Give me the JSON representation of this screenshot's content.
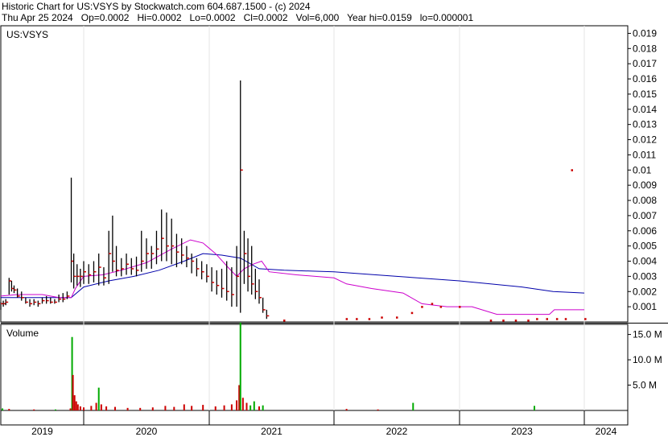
{
  "header": {
    "line1": "Historic Chart for US:VSYS by Stockwatch.com 604.687.1500 - (c) 2024",
    "line2": "Thu Apr 25 2024   Op=0.0002   Hi=0.0002   Lo=0.0002   Cl=0.0002   Vol=6,000   Year hi=0.0159   lo=0.000001"
  },
  "colors": {
    "price": "#000000",
    "close_tick": "#cc0000",
    "ma_short": "#cc00cc",
    "ma_long": "#0000aa",
    "vol_up": "#00aa00",
    "vol_down": "#cc0000"
  },
  "chart_data": [
    {
      "type": "line",
      "title": "US:VSYS",
      "x_labels": [
        "2019",
        "2020",
        "2021",
        "2022",
        "2023",
        "2024"
      ],
      "ylim": [
        0,
        0.0195
      ],
      "y_ticks": [
        "0.001",
        "0.002",
        "0.003",
        "0.004",
        "0.005",
        "0.006",
        "0.007",
        "0.008",
        "0.009",
        "0.01",
        "0.011",
        "0.012",
        "0.013",
        "0.014",
        "0.015",
        "0.016",
        "0.017",
        "0.018",
        "0.019"
      ],
      "price_hl": [
        {
          "x": 0.0,
          "hi": 0.0013,
          "lo": 0.0008,
          "c": 0.0012
        },
        {
          "x": 0.03,
          "hi": 0.0014,
          "lo": 0.001,
          "c": 0.0012
        },
        {
          "x": 0.06,
          "hi": 0.0015,
          "lo": 0.0011,
          "c": 0.0013
        },
        {
          "x": 0.1,
          "hi": 0.0029,
          "lo": 0.0018,
          "c": 0.0027
        },
        {
          "x": 0.13,
          "hi": 0.0027,
          "lo": 0.002,
          "c": 0.0022
        },
        {
          "x": 0.16,
          "hi": 0.0024,
          "lo": 0.0019,
          "c": 0.0021
        },
        {
          "x": 0.2,
          "hi": 0.0022,
          "lo": 0.0016,
          "c": 0.0017
        },
        {
          "x": 0.25,
          "hi": 0.002,
          "lo": 0.0014,
          "c": 0.0016
        },
        {
          "x": 0.3,
          "hi": 0.0016,
          "lo": 0.0012,
          "c": 0.0013
        },
        {
          "x": 0.35,
          "hi": 0.0015,
          "lo": 0.001,
          "c": 0.0012
        },
        {
          "x": 0.4,
          "hi": 0.0015,
          "lo": 0.0011,
          "c": 0.0013
        },
        {
          "x": 0.45,
          "hi": 0.0014,
          "lo": 0.001,
          "c": 0.0012
        },
        {
          "x": 0.5,
          "hi": 0.0016,
          "lo": 0.0012,
          "c": 0.0014
        },
        {
          "x": 0.55,
          "hi": 0.0017,
          "lo": 0.0012,
          "c": 0.0014
        },
        {
          "x": 0.6,
          "hi": 0.0016,
          "lo": 0.0012,
          "c": 0.0013
        },
        {
          "x": 0.65,
          "hi": 0.0015,
          "lo": 0.0012,
          "c": 0.0013
        },
        {
          "x": 0.7,
          "hi": 0.0018,
          "lo": 0.0013,
          "c": 0.0015
        },
        {
          "x": 0.75,
          "hi": 0.0019,
          "lo": 0.0013,
          "c": 0.0015
        },
        {
          "x": 0.8,
          "hi": 0.002,
          "lo": 0.0015,
          "c": 0.0017
        },
        {
          "x": 0.85,
          "hi": 0.0095,
          "lo": 0.0026,
          "c": 0.004
        },
        {
          "x": 0.88,
          "hi": 0.0045,
          "lo": 0.0022,
          "c": 0.003
        },
        {
          "x": 0.92,
          "hi": 0.0038,
          "lo": 0.0024,
          "c": 0.003
        },
        {
          "x": 0.96,
          "hi": 0.0035,
          "lo": 0.0023,
          "c": 0.003
        },
        {
          "x": 1.0,
          "hi": 0.004,
          "lo": 0.0025,
          "c": 0.0033
        },
        {
          "x": 1.04,
          "hi": 0.0038,
          "lo": 0.0025,
          "c": 0.0031
        },
        {
          "x": 1.08,
          "hi": 0.004,
          "lo": 0.0026,
          "c": 0.0033
        },
        {
          "x": 1.12,
          "hi": 0.0045,
          "lo": 0.0024,
          "c": 0.0036
        },
        {
          "x": 1.16,
          "hi": 0.0036,
          "lo": 0.0024,
          "c": 0.0029
        },
        {
          "x": 1.2,
          "hi": 0.006,
          "lo": 0.0025,
          "c": 0.0045
        },
        {
          "x": 1.23,
          "hi": 0.007,
          "lo": 0.0033,
          "c": 0.004
        },
        {
          "x": 1.26,
          "hi": 0.005,
          "lo": 0.003,
          "c": 0.0034
        },
        {
          "x": 1.3,
          "hi": 0.0042,
          "lo": 0.003,
          "c": 0.0035
        },
        {
          "x": 1.34,
          "hi": 0.0045,
          "lo": 0.0031,
          "c": 0.0038
        },
        {
          "x": 1.38,
          "hi": 0.0042,
          "lo": 0.0031,
          "c": 0.0035
        },
        {
          "x": 1.42,
          "hi": 0.0043,
          "lo": 0.003,
          "c": 0.0034
        },
        {
          "x": 1.46,
          "hi": 0.006,
          "lo": 0.0033,
          "c": 0.004
        },
        {
          "x": 1.5,
          "hi": 0.0055,
          "lo": 0.0035,
          "c": 0.0045
        },
        {
          "x": 1.54,
          "hi": 0.005,
          "lo": 0.0035,
          "c": 0.0045
        },
        {
          "x": 1.58,
          "hi": 0.006,
          "lo": 0.0038,
          "c": 0.0048
        },
        {
          "x": 1.62,
          "hi": 0.0074,
          "lo": 0.004,
          "c": 0.0055
        },
        {
          "x": 1.66,
          "hi": 0.0072,
          "lo": 0.004,
          "c": 0.005
        },
        {
          "x": 1.7,
          "hi": 0.0068,
          "lo": 0.0038,
          "c": 0.005
        },
        {
          "x": 1.74,
          "hi": 0.0058,
          "lo": 0.0036,
          "c": 0.0046
        },
        {
          "x": 1.78,
          "hi": 0.0055,
          "lo": 0.0038,
          "c": 0.0044
        },
        {
          "x": 1.82,
          "hi": 0.005,
          "lo": 0.0036,
          "c": 0.0042
        },
        {
          "x": 1.86,
          "hi": 0.0045,
          "lo": 0.0032,
          "c": 0.004
        },
        {
          "x": 1.9,
          "hi": 0.0042,
          "lo": 0.003,
          "c": 0.0035
        },
        {
          "x": 1.94,
          "hi": 0.004,
          "lo": 0.0028,
          "c": 0.0033
        },
        {
          "x": 1.98,
          "hi": 0.0038,
          "lo": 0.0026,
          "c": 0.003
        },
        {
          "x": 2.02,
          "hi": 0.0036,
          "lo": 0.002,
          "c": 0.0026
        },
        {
          "x": 2.06,
          "hi": 0.0034,
          "lo": 0.0018,
          "c": 0.0024
        },
        {
          "x": 2.1,
          "hi": 0.0035,
          "lo": 0.0016,
          "c": 0.0022
        },
        {
          "x": 2.14,
          "hi": 0.004,
          "lo": 0.0014,
          "c": 0.002
        },
        {
          "x": 2.18,
          "hi": 0.0036,
          "lo": 0.001,
          "c": 0.0018
        },
        {
          "x": 2.22,
          "hi": 0.005,
          "lo": 0.001,
          "c": 0.003
        },
        {
          "x": 2.25,
          "hi": 0.0159,
          "lo": 0.0006,
          "c": 0.01
        },
        {
          "x": 2.28,
          "hi": 0.006,
          "lo": 0.0025,
          "c": 0.0045
        },
        {
          "x": 2.31,
          "hi": 0.0055,
          "lo": 0.002,
          "c": 0.003
        },
        {
          "x": 2.34,
          "hi": 0.005,
          "lo": 0.0018,
          "c": 0.0025
        },
        {
          "x": 2.37,
          "hi": 0.0035,
          "lo": 0.0015,
          "c": 0.002
        },
        {
          "x": 2.4,
          "hi": 0.0028,
          "lo": 0.0012,
          "c": 0.0016
        },
        {
          "x": 2.43,
          "hi": 0.0016,
          "lo": 0.0006,
          "c": 0.0008
        },
        {
          "x": 2.46,
          "hi": 0.0008,
          "lo": 0.0002,
          "c": 0.0004
        }
      ],
      "close_dots": [
        {
          "x": 2.6,
          "y": 0.0001
        },
        {
          "x": 3.1,
          "y": 0.0002
        },
        {
          "x": 3.18,
          "y": 0.0002
        },
        {
          "x": 3.28,
          "y": 0.0002
        },
        {
          "x": 3.38,
          "y": 0.0003
        },
        {
          "x": 3.5,
          "y": 0.0003
        },
        {
          "x": 3.62,
          "y": 0.0006
        },
        {
          "x": 3.7,
          "y": 0.001
        },
        {
          "x": 3.78,
          "y": 0.0012
        },
        {
          "x": 3.85,
          "y": 0.001
        },
        {
          "x": 4.0,
          "y": 0.001
        },
        {
          "x": 4.25,
          "y": 0.0001
        },
        {
          "x": 4.35,
          "y": 0.0001
        },
        {
          "x": 4.45,
          "y": 0.0001
        },
        {
          "x": 4.55,
          "y": 0.0001
        },
        {
          "x": 4.62,
          "y": 0.0002
        },
        {
          "x": 4.7,
          "y": 0.0002
        },
        {
          "x": 4.78,
          "y": 0.0002
        },
        {
          "x": 4.85,
          "y": 0.0002
        },
        {
          "x": 4.9,
          "y": 0.01
        },
        {
          "x": 5.02,
          "y": 0.0002
        }
      ],
      "ma_short": [
        {
          "x": 0.0,
          "y": 0.0017
        },
        {
          "x": 0.2,
          "y": 0.0018
        },
        {
          "x": 0.5,
          "y": 0.0018
        },
        {
          "x": 0.7,
          "y": 0.0016
        },
        {
          "x": 0.85,
          "y": 0.0016
        },
        {
          "x": 0.9,
          "y": 0.0022
        },
        {
          "x": 1.0,
          "y": 0.003
        },
        {
          "x": 1.15,
          "y": 0.0031
        },
        {
          "x": 1.3,
          "y": 0.0034
        },
        {
          "x": 1.5,
          "y": 0.0039
        },
        {
          "x": 1.7,
          "y": 0.0048
        },
        {
          "x": 1.85,
          "y": 0.0054
        },
        {
          "x": 1.95,
          "y": 0.0052
        },
        {
          "x": 2.05,
          "y": 0.0045
        },
        {
          "x": 2.15,
          "y": 0.0036
        },
        {
          "x": 2.22,
          "y": 0.003
        },
        {
          "x": 2.28,
          "y": 0.0035
        },
        {
          "x": 2.35,
          "y": 0.0038
        },
        {
          "x": 2.42,
          "y": 0.004
        },
        {
          "x": 2.48,
          "y": 0.0033
        },
        {
          "x": 2.7,
          "y": 0.0031
        },
        {
          "x": 3.0,
          "y": 0.0029
        },
        {
          "x": 3.1,
          "y": 0.0025
        },
        {
          "x": 3.3,
          "y": 0.0022
        },
        {
          "x": 3.55,
          "y": 0.0019
        },
        {
          "x": 3.7,
          "y": 0.0012
        },
        {
          "x": 3.9,
          "y": 0.001
        },
        {
          "x": 4.1,
          "y": 0.001
        },
        {
          "x": 4.3,
          "y": 0.0005
        },
        {
          "x": 4.6,
          "y": 0.0005
        },
        {
          "x": 4.72,
          "y": 0.0005
        },
        {
          "x": 4.76,
          "y": 0.0008
        },
        {
          "x": 5.0,
          "y": 0.0008
        }
      ],
      "ma_long": [
        {
          "x": 0.0,
          "y": 0.0016
        },
        {
          "x": 0.5,
          "y": 0.0016
        },
        {
          "x": 0.85,
          "y": 0.0016
        },
        {
          "x": 1.0,
          "y": 0.0023
        },
        {
          "x": 1.2,
          "y": 0.0027
        },
        {
          "x": 1.4,
          "y": 0.003
        },
        {
          "x": 1.6,
          "y": 0.0034
        },
        {
          "x": 1.8,
          "y": 0.004
        },
        {
          "x": 1.95,
          "y": 0.0045
        },
        {
          "x": 2.1,
          "y": 0.0044
        },
        {
          "x": 2.25,
          "y": 0.0042
        },
        {
          "x": 2.4,
          "y": 0.0035
        },
        {
          "x": 2.6,
          "y": 0.0034
        },
        {
          "x": 3.0,
          "y": 0.0033
        },
        {
          "x": 3.5,
          "y": 0.003
        },
        {
          "x": 4.0,
          "y": 0.0027
        },
        {
          "x": 4.5,
          "y": 0.0023
        },
        {
          "x": 4.75,
          "y": 0.002
        },
        {
          "x": 5.0,
          "y": 0.0019
        }
      ]
    },
    {
      "type": "bar",
      "title": "Volume",
      "ylim": [
        0,
        17000000
      ],
      "y_ticks": [
        "5.0 M",
        "10.0 M",
        "15.0 M"
      ],
      "bars": [
        {
          "x": 0.02,
          "v": 400000,
          "up": true
        },
        {
          "x": 0.1,
          "v": 300000,
          "up": false
        },
        {
          "x": 0.4,
          "v": 200000,
          "up": false
        },
        {
          "x": 0.66,
          "v": 200000,
          "up": true
        },
        {
          "x": 0.84,
          "v": 400000,
          "up": false
        },
        {
          "x": 0.86,
          "v": 14500000,
          "up": true
        },
        {
          "x": 0.87,
          "v": 7000000,
          "up": false
        },
        {
          "x": 0.89,
          "v": 3000000,
          "up": false
        },
        {
          "x": 0.91,
          "v": 1800000,
          "up": false
        },
        {
          "x": 0.93,
          "v": 1200000,
          "up": false
        },
        {
          "x": 0.96,
          "v": 800000,
          "up": false
        },
        {
          "x": 1.0,
          "v": 600000,
          "up": false
        },
        {
          "x": 1.06,
          "v": 900000,
          "up": false
        },
        {
          "x": 1.1,
          "v": 1500000,
          "up": false
        },
        {
          "x": 1.12,
          "v": 4500000,
          "up": true
        },
        {
          "x": 1.14,
          "v": 1200000,
          "up": false
        },
        {
          "x": 1.18,
          "v": 800000,
          "up": false
        },
        {
          "x": 1.25,
          "v": 700000,
          "up": false
        },
        {
          "x": 1.35,
          "v": 500000,
          "up": false
        },
        {
          "x": 1.45,
          "v": 500000,
          "up": false
        },
        {
          "x": 1.55,
          "v": 600000,
          "up": false
        },
        {
          "x": 1.65,
          "v": 900000,
          "up": false
        },
        {
          "x": 1.72,
          "v": 700000,
          "up": false
        },
        {
          "x": 1.8,
          "v": 1200000,
          "up": false
        },
        {
          "x": 1.86,
          "v": 900000,
          "up": false
        },
        {
          "x": 1.95,
          "v": 1100000,
          "up": false
        },
        {
          "x": 2.05,
          "v": 800000,
          "up": false
        },
        {
          "x": 2.12,
          "v": 1000000,
          "up": false
        },
        {
          "x": 2.18,
          "v": 1200000,
          "up": false
        },
        {
          "x": 2.22,
          "v": 2000000,
          "up": false
        },
        {
          "x": 2.24,
          "v": 5000000,
          "up": false
        },
        {
          "x": 2.25,
          "v": 20500000,
          "up": true
        },
        {
          "x": 2.27,
          "v": 2500000,
          "up": false
        },
        {
          "x": 2.3,
          "v": 1500000,
          "up": false
        },
        {
          "x": 2.33,
          "v": 1000000,
          "up": true
        },
        {
          "x": 2.36,
          "v": 1800000,
          "up": true
        },
        {
          "x": 2.4,
          "v": 800000,
          "up": false
        },
        {
          "x": 2.43,
          "v": 1000000,
          "up": true
        },
        {
          "x": 3.1,
          "v": 300000,
          "up": false
        },
        {
          "x": 3.35,
          "v": 200000,
          "up": false
        },
        {
          "x": 3.63,
          "v": 1500000,
          "up": true
        },
        {
          "x": 4.6,
          "v": 900000,
          "up": true
        }
      ]
    }
  ]
}
